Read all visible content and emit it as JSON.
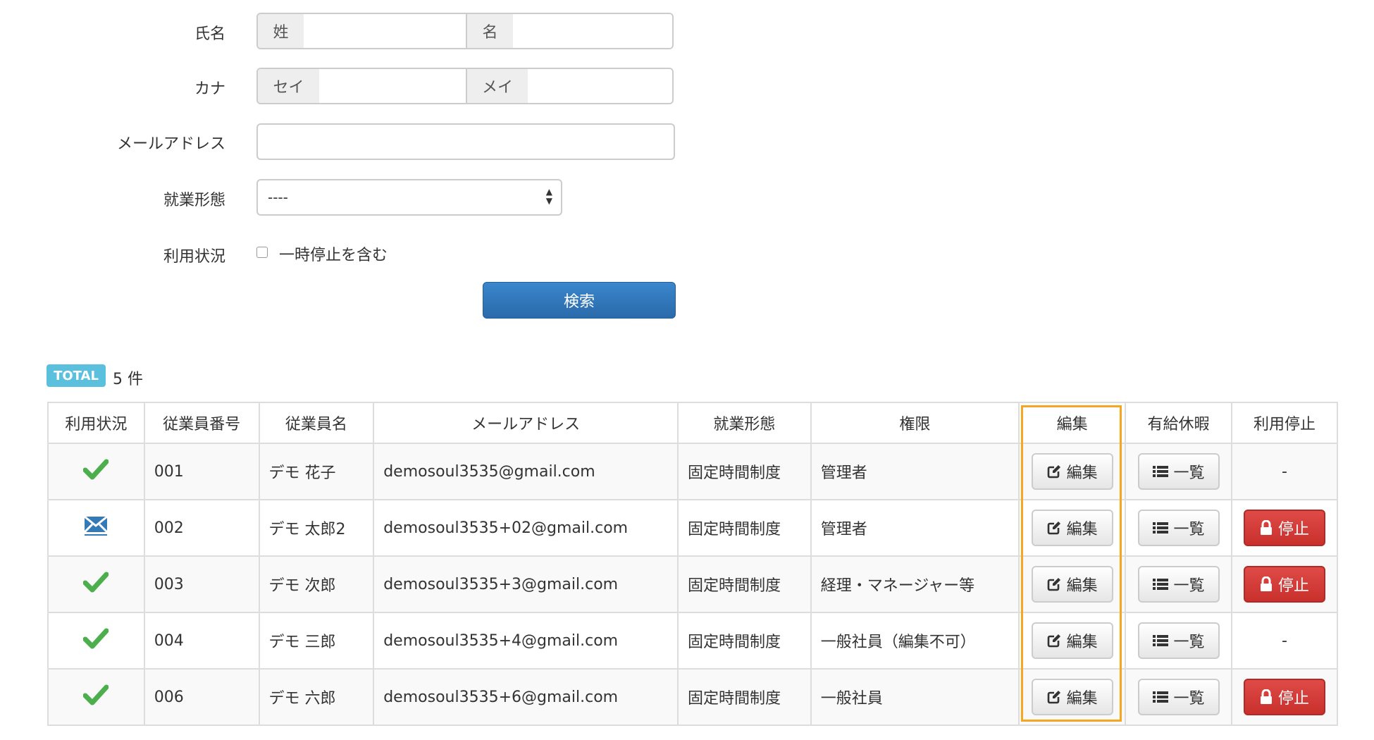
{
  "form": {
    "name_label": "氏名",
    "last_name_addon": "姓",
    "first_name_addon": "名",
    "last_name_value": "",
    "first_name_value": "",
    "kana_label": "カナ",
    "kana_last_addon": "セイ",
    "kana_first_addon": "メイ",
    "kana_last_value": "",
    "kana_first_value": "",
    "email_label": "メールアドレス",
    "email_value": "",
    "employment_label": "就業形態",
    "employment_selected": "----",
    "status_label": "利用状況",
    "include_suspended_label": "一時停止を含む",
    "include_suspended_checked": false,
    "search_button": "検索"
  },
  "total": {
    "badge": "TOTAL",
    "count_text": "5 件"
  },
  "table": {
    "headers": [
      "利用状況",
      "従業員番号",
      "従業員名",
      "メールアドレス",
      "就業形態",
      "権限",
      "編集",
      "有給休暇",
      "利用停止"
    ],
    "rows": [
      {
        "status": "check",
        "id": "001",
        "name": "デモ 花子",
        "email": "demosoul3535@gmail.com",
        "employment": "固定時間制度",
        "role": "管理者",
        "edit": "編集",
        "leave": "一覧",
        "suspend": "-"
      },
      {
        "status": "mail",
        "id": "002",
        "name": "デモ 太郎2",
        "email": "demosoul3535+02@gmail.com",
        "employment": "固定時間制度",
        "role": "管理者",
        "edit": "編集",
        "leave": "一覧",
        "suspend": "停止"
      },
      {
        "status": "check",
        "id": "003",
        "name": "デモ 次郎",
        "email": "demosoul3535+3@gmail.com",
        "employment": "固定時間制度",
        "role": "経理・マネージャー等",
        "edit": "編集",
        "leave": "一覧",
        "suspend": "停止"
      },
      {
        "status": "check",
        "id": "004",
        "name": "デモ 三郎",
        "email": "demosoul3535+4@gmail.com",
        "employment": "固定時間制度",
        "role": "一般社員（編集不可）",
        "edit": "編集",
        "leave": "一覧",
        "suspend": "-"
      },
      {
        "status": "check",
        "id": "006",
        "name": "デモ 六郎",
        "email": "demosoul3535+6@gmail.com",
        "employment": "固定時間制度",
        "role": "一般社員",
        "edit": "編集",
        "leave": "一覧",
        "suspend": "停止"
      }
    ]
  },
  "colors": {
    "check": "#4cae4c",
    "mail": "#337ab7",
    "danger": "#d9534f",
    "primary": "#337ab7",
    "badge": "#5bc0de",
    "highlight": "#f5a623"
  },
  "icons": {
    "status_check": "check-icon",
    "status_mail": "mail-icon",
    "edit": "edit-icon",
    "list": "list-icon",
    "lock": "lock-icon"
  }
}
